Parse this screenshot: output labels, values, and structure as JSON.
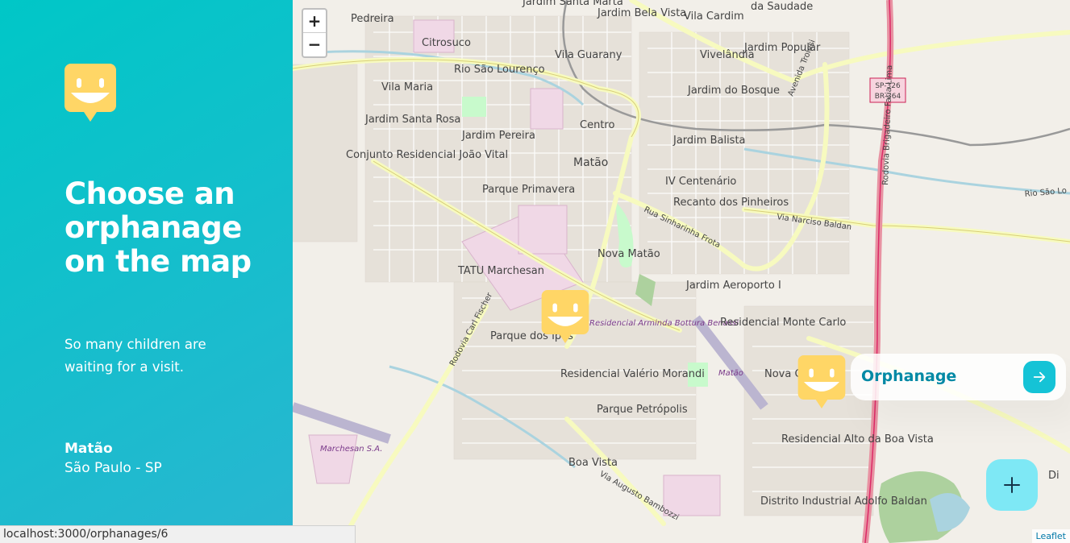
{
  "sidebar": {
    "title": "Choose an orphanage on the map",
    "subtitle": "So many children are waiting for a visit.",
    "location": {
      "city": "Matão",
      "state": "São Paulo - SP"
    },
    "logo_icon": "happy-face-marker-icon"
  },
  "map": {
    "zoom_in": "+",
    "zoom_out": "−",
    "attribution": "Leaflet",
    "labels": [
      "Pedreira",
      "Citrosuco",
      "Rio São Lourenço",
      "Vila Maria",
      "Jardim Santa Rosa",
      "Conjunto Residencial João Vital",
      "Jardim Pereira",
      "Matão",
      "Centro",
      "Parque Primavera",
      "Jardim Santa Marta",
      "Jardim Bela Vista",
      "Vila Cardim",
      "da Saudade",
      "Vila Guarany",
      "Vivelândia",
      "Jardim Popular",
      "Jardim do Bosque",
      "Jardim Balista",
      "IV Centenário",
      "Recanto dos Pinheiros",
      "Nova Matão",
      "Jardim Aeroporto I",
      "TATU Marchesan",
      "Parque dos Ipês",
      "Residencial Arminda Bottura Benassi",
      "Residencial Valério Morandi",
      "Parque Petrópolis",
      "Residencial Monte Carlo",
      "Matão",
      "Nova C",
      "Residencial Alto da Boa Vista",
      "Boa Vista",
      "Distrito Industrial Adolfo Baldan",
      "Marchesan S.A.",
      "Rua Sinharinha Frota",
      "Via Narciso Baldan",
      "Via Augusto Bambozzi",
      "Rodovia Carl Fischer",
      "Rodovia Brigadeiro Faria Lima",
      "Avenida Trolesi",
      "SP-326 BR-364",
      "Rio São Lo",
      "Di"
    ]
  },
  "markers": [
    {
      "name": "orphanage-marker-1"
    },
    {
      "name": "orphanage-marker-2"
    }
  ],
  "popup": {
    "title": "Orphanage",
    "button_icon": "arrow-right-icon"
  },
  "add_button": {
    "icon": "plus-icon"
  },
  "statusbar": {
    "url": "localhost:3000/orphanages/6"
  },
  "colors": {
    "sidebar_gradient_start": "#00c7c7",
    "sidebar_gradient_end": "#29b6d1",
    "marker_yellow": "#ffd666",
    "popup_title": "#0089a5",
    "popup_button": "#15c3d6",
    "add_button": "#7ee8f5"
  }
}
